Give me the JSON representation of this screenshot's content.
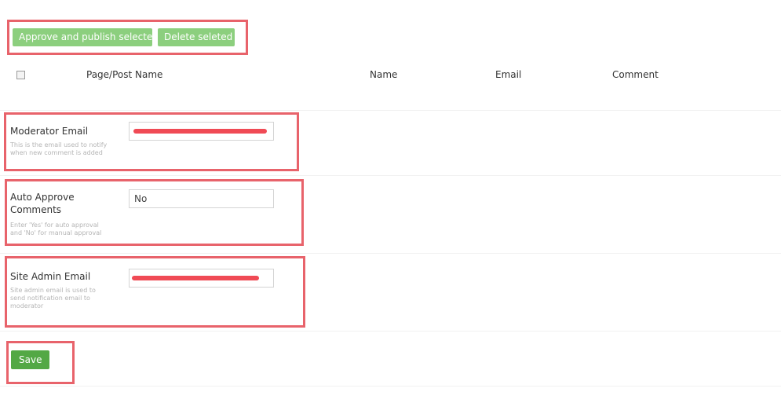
{
  "bulk_actions": {
    "approve_label": "Approve and publish selected",
    "delete_label": "Delete seleted"
  },
  "table": {
    "columns": [
      "Page/Post Name",
      "Name",
      "Email",
      "Comment"
    ]
  },
  "settings": {
    "moderator_email": {
      "label": "Moderator Email",
      "description": "This is the email used to notify when new comment is added",
      "value": ""
    },
    "auto_approve": {
      "label": "Auto Approve Comments",
      "description": "Enter 'Yes' for auto approval and 'No' for manual approval",
      "value": "No"
    },
    "site_admin_email": {
      "label": "Site Admin Email",
      "description": "Site admin email is used to send notification email to moderator",
      "value": ""
    }
  },
  "save_label": "Save",
  "colors": {
    "highlight": "#e8636b",
    "button": "#8ccf7e",
    "save_button": "#53a845",
    "redaction": "#f04a55"
  }
}
